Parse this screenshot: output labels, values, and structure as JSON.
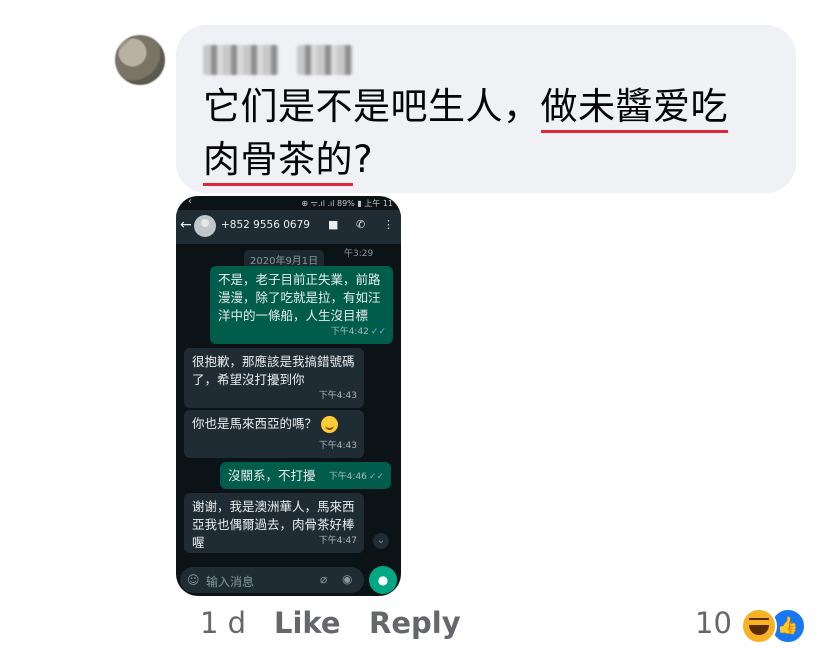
{
  "comment": {
    "text_plain": "它们是不是吧生人，",
    "text_underlined_1": "做未醬爱吃",
    "text_underlined_2": "肉骨茶的",
    "text_end": "?"
  },
  "screenshot": {
    "status": "⊕ ᯤ.ıl .ıl 89% ▮ 上午 11",
    "phone_number": "+852 9556 0679",
    "date_chip": "2020年9月1日",
    "messages": [
      {
        "dir": "out",
        "text": "不是，老子目前正失業，前路漫漫，除了吃就是拉，有如汪洋中的一條船，人生沒目標",
        "time": "下午4:42"
      },
      {
        "dir": "in",
        "text": "很抱歉，那應該是我搞錯號碼了，希望沒打擾到你",
        "time": "下午4:43"
      },
      {
        "dir": "in",
        "text": "你也是馬來西亞的嗎？",
        "time": "下午4:43"
      },
      {
        "dir": "out",
        "text": "沒關系，不打擾",
        "time": "下午4:46"
      },
      {
        "dir": "in",
        "text": "谢谢，我是澳洲華人，馬來西亞我也偶爾過去，肉骨茶好棒喔",
        "time": "下午4:47"
      }
    ],
    "partial_time": "午3:29",
    "input_placeholder": "输入消息"
  },
  "footer": {
    "time": "1 d",
    "like": "Like",
    "reply": "Reply",
    "reaction_count": "10"
  }
}
